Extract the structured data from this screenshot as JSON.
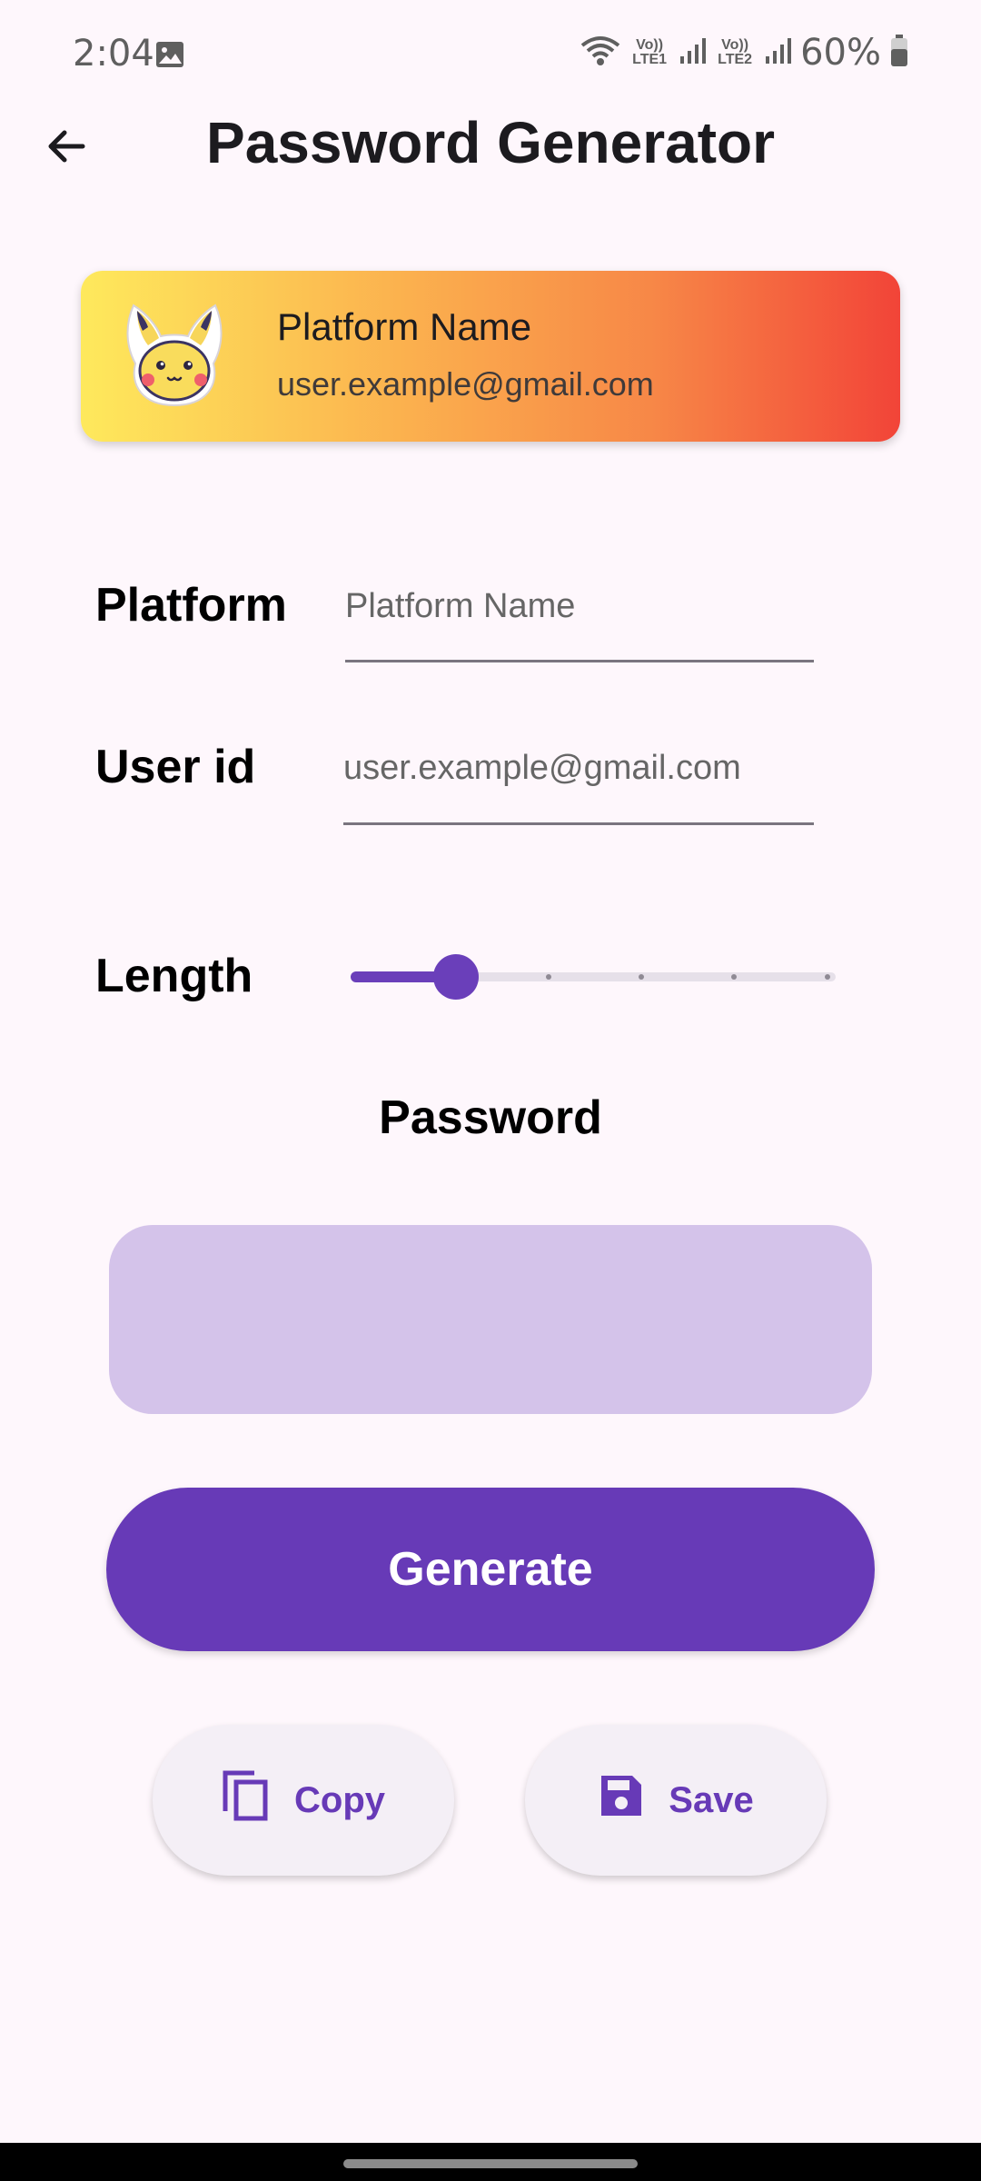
{
  "status_bar": {
    "time": "2:04",
    "battery_pct": "60%",
    "net1": "Vo)) LTE1",
    "net2": "Vo)) LTE2",
    "icons": [
      "image-icon",
      "wifi-icon",
      "signal-icon",
      "battery-icon"
    ]
  },
  "header": {
    "title": "Password Generator",
    "back_icon": "arrow-back-icon"
  },
  "card": {
    "title": "Platform Name",
    "subtitle": "user.example@gmail.com",
    "avatar": "pikachu-avatar",
    "gradient": [
      "#fee95c",
      "#fbb04e",
      "#f78747",
      "#f24438"
    ]
  },
  "form": {
    "platform_label": "Platform",
    "platform_placeholder": "Platform Name",
    "userid_label": "User id",
    "userid_placeholder": "user.example@gmail.com",
    "length_label": "Length"
  },
  "slider": {
    "value_fraction": 0.2,
    "steps": 5
  },
  "password": {
    "title": "Password",
    "value": ""
  },
  "buttons": {
    "generate": "Generate",
    "copy": "Copy",
    "save": "Save"
  },
  "colors": {
    "accent": "#673ab7",
    "password_box": "#d4c3ea",
    "background": "#fef7fc"
  }
}
